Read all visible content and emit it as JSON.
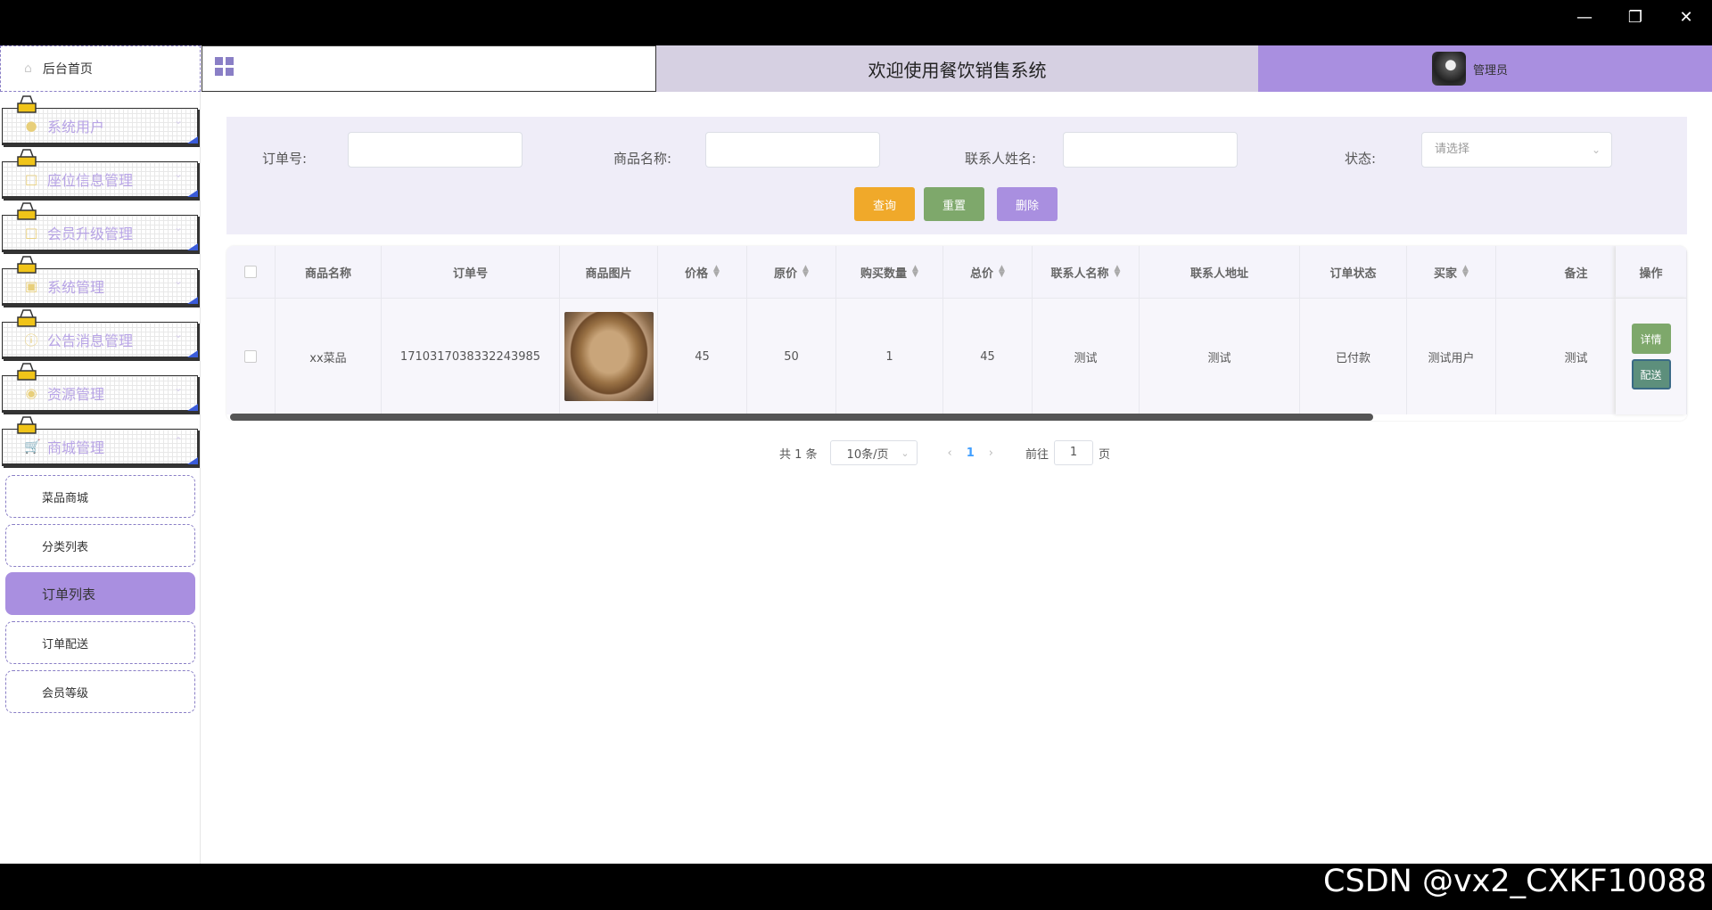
{
  "watermark": "CSDN @vx2_CXKF10088",
  "window": {
    "minimize_icon": "minimize-icon",
    "maximize_icon": "restore-icon",
    "close_icon": "close-icon"
  },
  "sidebar": {
    "home": "后台首页",
    "menus": [
      {
        "label": "系统用户",
        "icon": "user-icon"
      },
      {
        "label": "座位信息管理",
        "icon": "edit-icon"
      },
      {
        "label": "会员升级管理",
        "icon": "edit-icon"
      },
      {
        "label": "系统管理",
        "icon": "image-icon"
      },
      {
        "label": "公告消息管理",
        "icon": "info-icon"
      },
      {
        "label": "资源管理",
        "icon": "location-icon"
      },
      {
        "label": "商城管理",
        "icon": "cart-icon"
      }
    ],
    "submenus": [
      {
        "label": "菜品商城",
        "active": false
      },
      {
        "label": "分类列表",
        "active": false
      },
      {
        "label": "订单列表",
        "active": true
      },
      {
        "label": "订单配送",
        "active": false
      },
      {
        "label": "会员等级",
        "active": false
      }
    ]
  },
  "header": {
    "title": "欢迎使用餐饮销售系统",
    "user": "管理员"
  },
  "search": {
    "order_no_label": "订单号:",
    "product_name_label": "商品名称:",
    "contact_name_label": "联系人姓名:",
    "status_label": "状态:",
    "status_placeholder": "请选择",
    "query": "查询",
    "reset": "重置",
    "delete": "删除"
  },
  "table": {
    "columns": [
      "商品名称",
      "订单号",
      "商品图片",
      "价格",
      "原价",
      "购买数量",
      "总价",
      "联系人名称",
      "联系人地址",
      "订单状态",
      "买家",
      "备注",
      "操作"
    ],
    "rows": [
      {
        "product_name": "xx菜品",
        "order_no": "1710317038332243985",
        "price": "45",
        "original_price": "50",
        "quantity": "1",
        "total": "45",
        "contact_name": "测试",
        "contact_address": "测试",
        "status": "已付款",
        "buyer": "测试用户",
        "remark": "测试",
        "actions": [
          "详情",
          "配送"
        ]
      }
    ]
  },
  "pagination": {
    "total": "共 1 条",
    "page_size": "10条/页",
    "current": "1",
    "goto_prefix": "前往",
    "goto_value": "1",
    "goto_suffix": "页"
  },
  "colors": {
    "accent": "#a98fe0",
    "query": "#f0a92a",
    "reset": "#7ea86b",
    "header_mid": "#d6d0e2"
  }
}
